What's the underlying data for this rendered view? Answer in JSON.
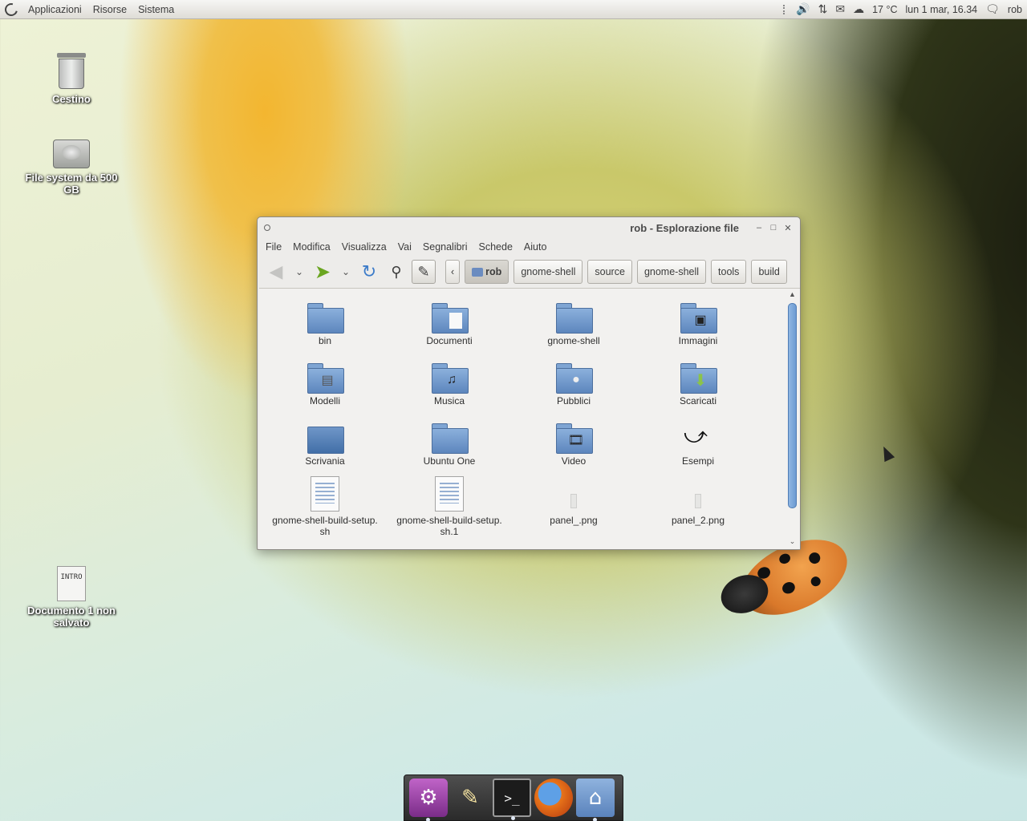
{
  "top_panel": {
    "menus": [
      "Applicazioni",
      "Risorse",
      "Sistema"
    ],
    "temperature": "17 °C",
    "clock": "lun  1 mar, 16.34",
    "user": "rob",
    "icons": [
      "volume-icon",
      "network-icon",
      "mail-icon",
      "weather-icon",
      "chat-icon"
    ]
  },
  "desktop": {
    "icons": [
      {
        "label": "Cestino",
        "icon": "trash-icon"
      },
      {
        "label": "File system da 500 GB",
        "icon": "harddisk-icon"
      },
      {
        "label": "Documento 1 non salvato",
        "icon": "text-document-icon",
        "thumb_text": "INTRO"
      }
    ]
  },
  "window": {
    "title": "rob - Esplorazione file",
    "menus": [
      "File",
      "Modifica",
      "Visualizza",
      "Vai",
      "Segnalibri",
      "Schede",
      "Aiuto"
    ],
    "breadcrumbs": [
      "rob",
      "gnome-shell",
      "source",
      "gnome-shell",
      "tools",
      "build"
    ],
    "active_breadcrumb": "rob",
    "items": [
      {
        "name": "bin",
        "type": "folder"
      },
      {
        "name": "Documenti",
        "type": "folder-documents"
      },
      {
        "name": "gnome-shell",
        "type": "folder"
      },
      {
        "name": "Immagini",
        "type": "folder-pictures"
      },
      {
        "name": "Modelli",
        "type": "folder-templates"
      },
      {
        "name": "Musica",
        "type": "folder-music"
      },
      {
        "name": "Pubblici",
        "type": "folder-public"
      },
      {
        "name": "Scaricati",
        "type": "folder-downloads"
      },
      {
        "name": "Scrivania",
        "type": "folder-desktop"
      },
      {
        "name": "Ubuntu One",
        "type": "folder"
      },
      {
        "name": "Video",
        "type": "folder-videos"
      },
      {
        "name": "Esempi",
        "type": "symlink"
      },
      {
        "name_line1": "gnome-shell-build-setup.",
        "name_line2": "sh",
        "type": "text-file"
      },
      {
        "name_line1": "gnome-shell-build-setup.",
        "name_line2": "sh.1",
        "type": "text-file"
      },
      {
        "name": "panel_.png",
        "type": "image-file"
      },
      {
        "name": "panel_2.png",
        "type": "image-file"
      }
    ]
  },
  "dock": {
    "apps": [
      "settings-icon",
      "paint-icon",
      "terminal-icon",
      "firefox-icon",
      "home-folder-icon"
    ]
  }
}
